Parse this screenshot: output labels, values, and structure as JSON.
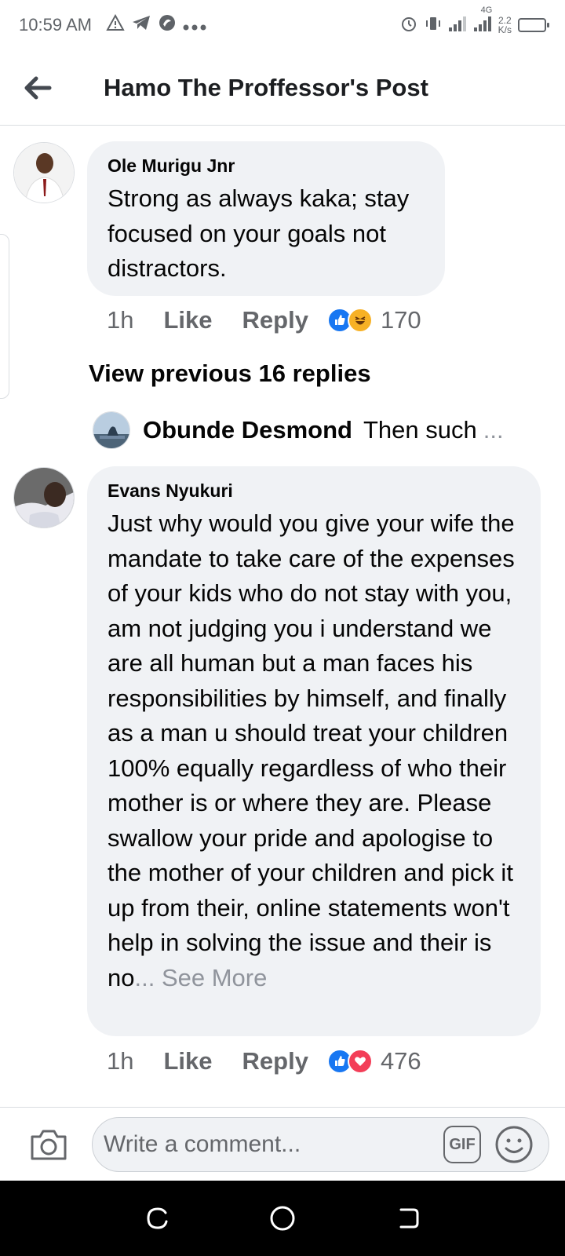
{
  "status_bar": {
    "time": "10:59 AM",
    "network_type": "4G",
    "speed_value": "2.2",
    "speed_unit": "K/s"
  },
  "header": {
    "title": "Hamo The Proffessor's Post"
  },
  "comments": [
    {
      "author": "Ole Murigu Jnr",
      "text": "Strong as always kaka; stay focused on your goals not distractors.",
      "time": "1h",
      "like_label": "Like",
      "reply_label": "Reply",
      "reaction_count": "170",
      "reactions": [
        "like-icon",
        "haha-icon"
      ]
    },
    {
      "author": "Evans Nyukuri",
      "text": "Just why would you give your wife the mandate to take care of the expenses of your kids who do not stay with you, am not judging you i understand we are all human but a man faces his responsibilities by himself, and finally as a man u should treat your children 100% equally regardless of who their mother is or where they are. Please swallow your pride and apologise to the mother of your children and pick it up from their, online statements won't help in solving the issue and their is no",
      "ellipsis": "...",
      "see_more": " See More",
      "time": "1h",
      "like_label": "Like",
      "reply_label": "Reply",
      "reaction_count": "476",
      "reactions": [
        "like-icon",
        "love-icon"
      ]
    }
  ],
  "view_previous": "View previous 16 replies",
  "reply_preview": {
    "author": "Obunde Desmond",
    "text": "Then such",
    "ellipsis": "..."
  },
  "composer": {
    "placeholder": "Write a comment...",
    "gif_label": "GIF"
  },
  "colors": {
    "bubble": "#f0f2f5",
    "meta_gray": "#65676b",
    "like_blue": "#1877f2",
    "love_red": "#f33e58",
    "haha_yellow": "#f7b125"
  }
}
